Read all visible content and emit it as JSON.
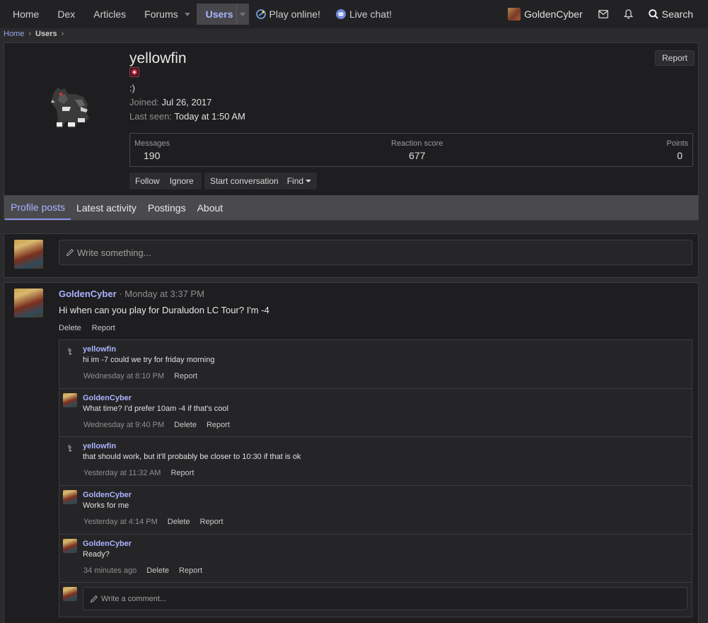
{
  "nav": {
    "items": [
      {
        "label": "Home"
      },
      {
        "label": "Dex"
      },
      {
        "label": "Articles"
      },
      {
        "label": "Forums"
      },
      {
        "label": "Users"
      },
      {
        "label": "Play online!"
      },
      {
        "label": "Live chat!"
      }
    ],
    "user_name": "GoldenCyber",
    "search_label": "Search"
  },
  "breadcrumb": {
    "home": "Home",
    "users": "Users"
  },
  "profile": {
    "name": "yellowfin",
    "status": ":)",
    "joined_label": "Joined:",
    "joined_value": "Jul 26, 2017",
    "last_seen_label": "Last seen:",
    "last_seen_value": "Today at 1:50 AM",
    "report_label": "Report",
    "stats": {
      "messages_label": "Messages",
      "messages_value": "190",
      "reaction_label": "Reaction score",
      "reaction_value": "677",
      "points_label": "Points",
      "points_value": "0"
    },
    "actions": {
      "follow": "Follow",
      "ignore": "Ignore",
      "start_conversation": "Start conversation",
      "find": "Find"
    },
    "tabs": [
      {
        "label": "Profile posts"
      },
      {
        "label": "Latest activity"
      },
      {
        "label": "Postings"
      },
      {
        "label": "About"
      }
    ]
  },
  "new_post": {
    "placeholder": "Write something..."
  },
  "post": {
    "author": "GoldenCyber",
    "time": "· Monday at 3:37 PM",
    "body": "Hi when can you play for Duraludon LC Tour? I'm -4",
    "delete": "Delete",
    "report": "Report",
    "comments": [
      {
        "author": "yellowfin",
        "text": "hi im -7 could we try for friday morning",
        "time": "Wednesday at 8:10 PM",
        "delete": "",
        "report": "Report"
      },
      {
        "author": "GoldenCyber",
        "text": "What time? I'd prefer 10am -4 if that's cool",
        "time": "Wednesday at 9:40 PM",
        "delete": "Delete",
        "report": "Report"
      },
      {
        "author": "yellowfin",
        "text": "that should work, but it'll probably be closer to 10:30 if that is ok",
        "time": "Yesterday at 11:32 AM",
        "delete": "",
        "report": "Report"
      },
      {
        "author": "GoldenCyber",
        "text": "Works for me",
        "time": "Yesterday at 4:14 PM",
        "delete": "Delete",
        "report": "Report"
      },
      {
        "author": "GoldenCyber",
        "text": "Ready?",
        "time": "34 minutes ago",
        "delete": "Delete",
        "report": "Report"
      }
    ],
    "comment_placeholder": "Write a comment..."
  },
  "colors": {
    "accent": "#aab3ff",
    "background": "#2b2b2d",
    "card": "#1e1e20"
  },
  "icons": [
    "play-icon",
    "discord-icon",
    "mail-icon",
    "bell-icon",
    "search-icon",
    "pencil-icon",
    "chevron-right-icon",
    "caret-down-icon",
    "avatar-badge-icon"
  ]
}
